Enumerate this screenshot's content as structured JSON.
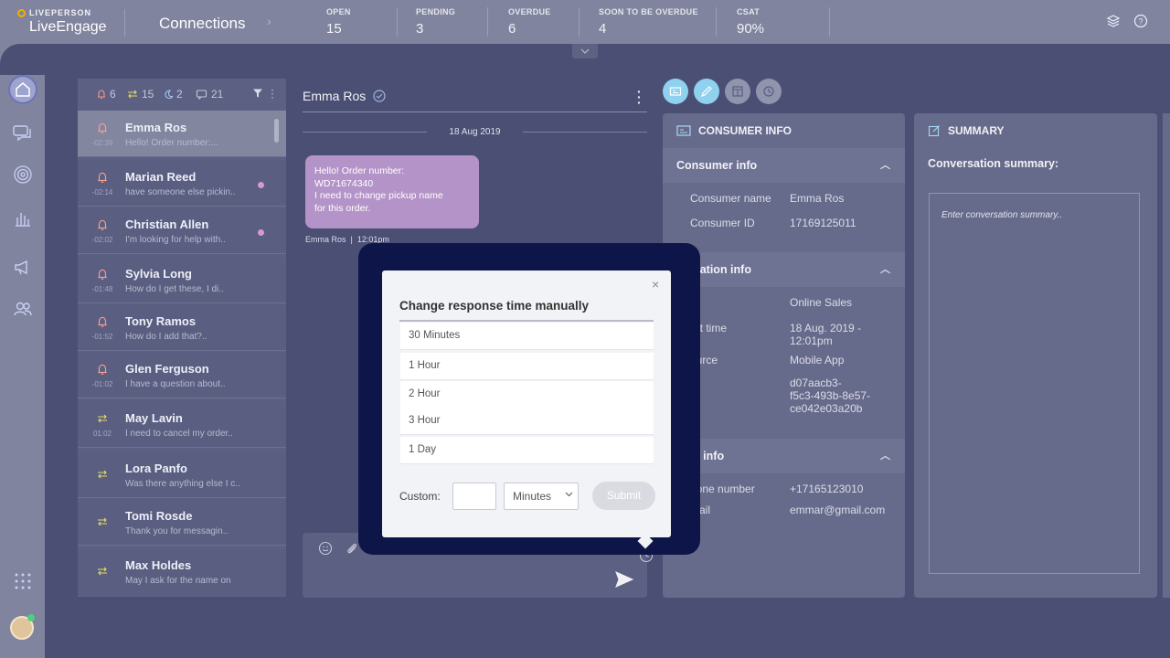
{
  "brand": {
    "company": "LIVEPERSON",
    "product": "LiveEngage"
  },
  "header": {
    "title": "Connections",
    "stats": [
      {
        "label": "OPEN",
        "value": "15"
      },
      {
        "label": "PENDING",
        "value": "3"
      },
      {
        "label": "OVERDUE",
        "value": "6"
      },
      {
        "label": "SOON TO BE OVERDUE",
        "value": "4"
      },
      {
        "label": "CSAT",
        "value": "90%"
      }
    ],
    "icons": [
      "layers-icon",
      "help-icon"
    ]
  },
  "sidenav": {
    "items": [
      "home-icon",
      "conversations-icon",
      "fingerprint-icon",
      "analytics-icon",
      "campaigns-icon",
      "users-icon",
      "apps-grid-icon"
    ]
  },
  "list_header": {
    "alerts": "6",
    "transfers": "15",
    "waiting": "2",
    "messages": "21"
  },
  "conversations": [
    {
      "name": "Emma Ros",
      "preview": "Hello! Order number:...",
      "time": "-02:39",
      "icon": "bell-icon",
      "unread": false
    },
    {
      "name": "Marian Reed",
      "preview": "have someone else pickin..",
      "time": "-02:14",
      "icon": "bell-icon",
      "unread": true
    },
    {
      "name": "Christian Allen",
      "preview": "I'm looking for help with..",
      "time": "-02:02",
      "icon": "bell-icon",
      "unread": true
    },
    {
      "name": "Sylvia Long",
      "preview": "How do I get these, I di..",
      "time": "-01:48",
      "icon": "bell-icon",
      "unread": false
    },
    {
      "name": "Tony Ramos",
      "preview": "How do I add that?..",
      "time": "-01:52",
      "icon": "bell-icon",
      "unread": false
    },
    {
      "name": "Glen Ferguson",
      "preview": "I have a question about..",
      "time": "-01:02",
      "icon": "bell-icon",
      "unread": false
    },
    {
      "name": "May Lavin",
      "preview": "I need to cancel my order..",
      "time": "01:02",
      "icon": "transfer-icon",
      "unread": false
    },
    {
      "name": "Lora Panfo",
      "preview": "Was there anything else I c..",
      "time": "",
      "icon": "transfer-icon",
      "unread": false
    },
    {
      "name": "Tomi Rosde",
      "preview": "Thank you for messagin..",
      "time": "",
      "icon": "transfer-icon",
      "unread": false
    },
    {
      "name": "Max Holdes",
      "preview": "May I ask for the name on",
      "time": "",
      "icon": "transfer-icon",
      "unread": false
    }
  ],
  "chat": {
    "name": "Emma Ros",
    "date": "18 Aug 2019",
    "message_lines": [
      "Hello! Order number:",
      "WD71674340",
      "I need to change pickup name",
      "for this order."
    ],
    "meta": "Emma Ros  |  12:01pm"
  },
  "consumer_panel": {
    "header": "CONSUMER INFO",
    "sections": {
      "consumer": "Consumer info",
      "conversation": "versation info",
      "personal": "onal info"
    },
    "fields": {
      "consumer_name_label": "Consumer name",
      "consumer_name": "Emma Ros",
      "consumer_id_label": "Consumer ID",
      "consumer_id": "17169125011",
      "skill_label": "ill",
      "skill": "Online Sales",
      "start_time_label": "art time",
      "start_time_1": "18 Aug. 2019 -",
      "start_time_2": "12:01pm",
      "source_label": "ource",
      "source": "Mobile App",
      "id_1": "d07aacb3-",
      "id_2": "f5c3-493b-8e57-",
      "id_3": "ce042e03a20b",
      "phone_label": "hone number",
      "phone": "+17165123010",
      "email_label": "mail",
      "email": "emmar@gmail.com"
    }
  },
  "summary_panel": {
    "header": "SUMMARY",
    "label": "Conversation summary:",
    "placeholder": "Enter conversation summary.."
  },
  "modal": {
    "title": "Change response time manually",
    "options": [
      "30 Minutes",
      "1 Hour",
      "2 Hour",
      "3 Hour",
      "1 Day"
    ],
    "custom_label": "Custom:",
    "custom_value": "",
    "unit": "Minutes",
    "submit": "Submit",
    "close": "×"
  },
  "colors": {
    "accent": "#8fd2f0",
    "unread": "#d59ad4",
    "bubble": "#b494c8",
    "modal_frame": "#0e1548"
  }
}
